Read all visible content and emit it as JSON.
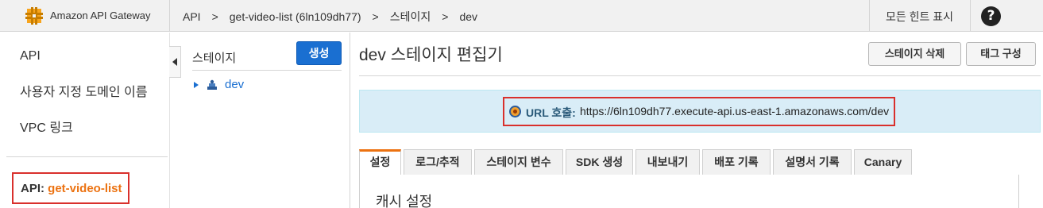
{
  "topbar": {
    "brand": "Amazon API Gateway",
    "breadcrumbs": [
      "API",
      "get-video-list (6ln109dh77)",
      "스테이지",
      "dev"
    ],
    "separator": ">",
    "hints_label": "모든 힌트 표시",
    "help": "?"
  },
  "sidebar": {
    "items": [
      "API",
      "사용자 지정 도메인 이름",
      "VPC 링크"
    ],
    "api_prefix": "API:",
    "api_name": "get-video-list"
  },
  "stages": {
    "title": "스테이지",
    "create_label": "생성",
    "items": [
      {
        "name": "dev"
      }
    ]
  },
  "main": {
    "title": "dev 스테이지 편집기",
    "delete_stage_label": "스테이지 삭제",
    "tags_label": "태그 구성",
    "invoke_url_label": "URL 호출:",
    "invoke_url": "https://6ln109dh77.execute-api.us-east-1.amazonaws.com/dev",
    "tabs": [
      "설정",
      "로그/추적",
      "스테이지 변수",
      "SDK 생성",
      "내보내기",
      "배포 기록",
      "설명서 기록",
      "Canary"
    ],
    "active_tab": "설정",
    "section_title": "캐시 설정"
  },
  "colors": {
    "accent_orange": "#ec7211",
    "primary_blue": "#1a6fd1",
    "highlight_red": "#d9302c",
    "info_panel": "#d9edf7"
  }
}
